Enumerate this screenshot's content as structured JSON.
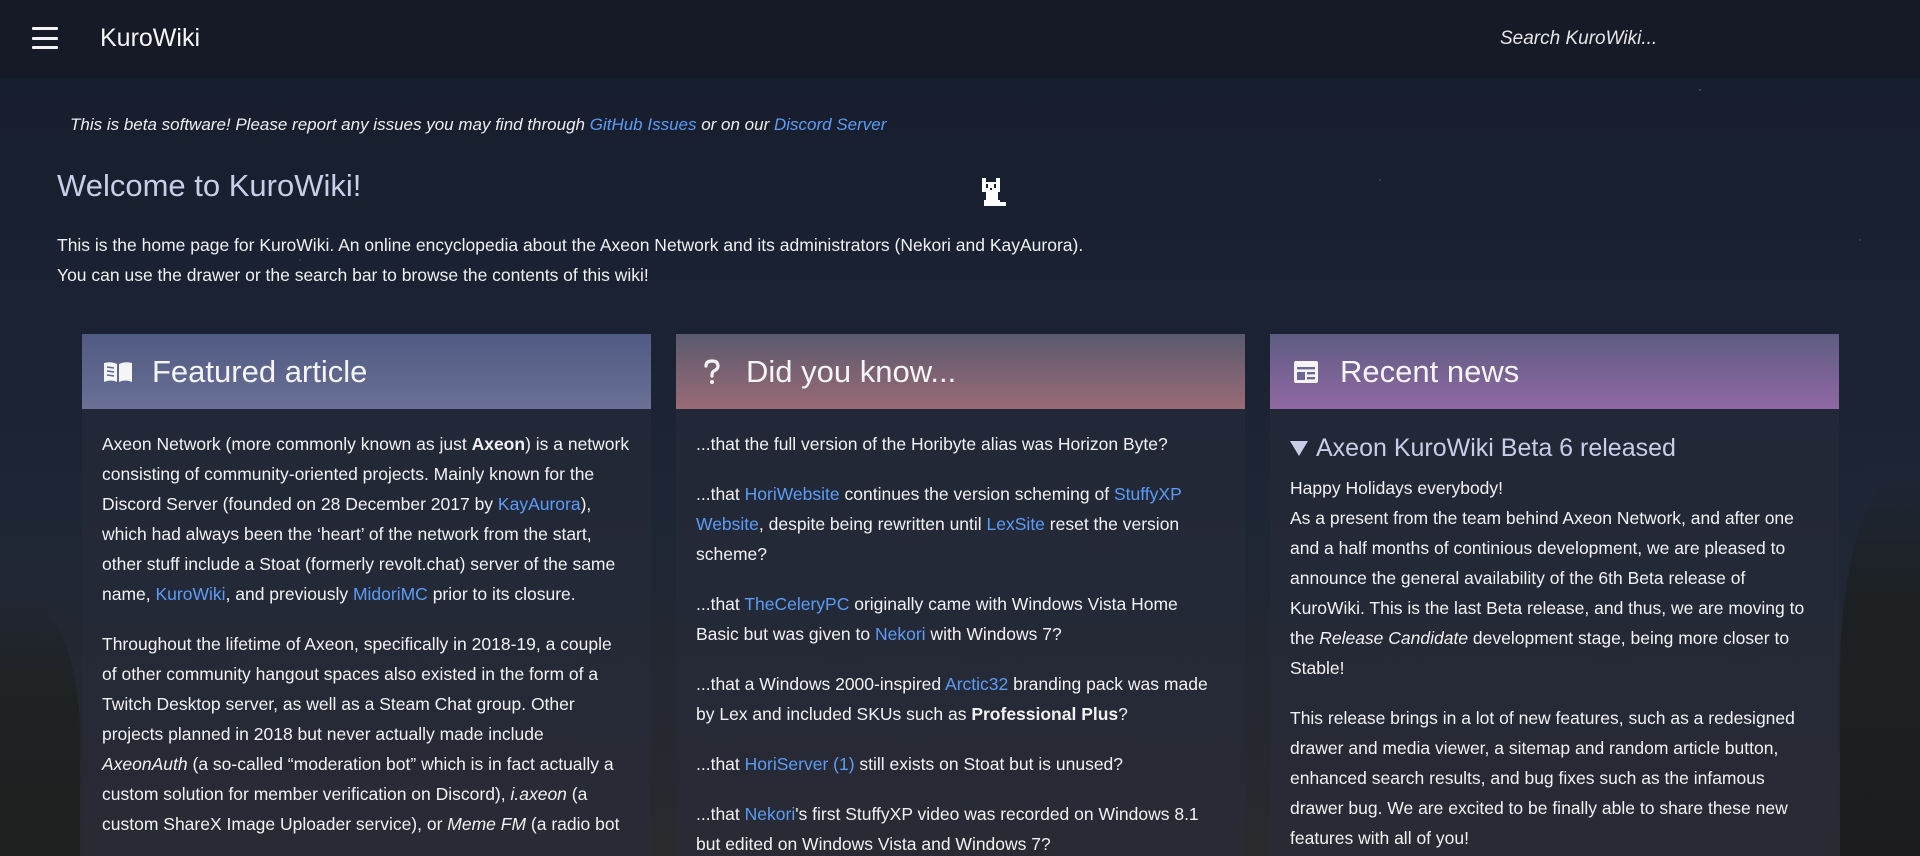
{
  "app": {
    "title": "KuroWiki"
  },
  "search": {
    "placeholder": "Search KuroWiki..."
  },
  "notice": {
    "text_before": "This is beta software! Please report any issues you may find through ",
    "github_link": "GitHub Issues",
    "text_middle": " or on our ",
    "discord_link": "Discord Server"
  },
  "page": {
    "title": "Welcome to KuroWiki!",
    "intro_line1": "This is the home page for KuroWiki. An online encyclopedia about the Axeon Network and its administrators (Nekori and KayAurora).",
    "intro_line2": "You can use the drawer or the search bar to browse the contents of this wiki!"
  },
  "featured": {
    "heading": "Featured article",
    "icon": "book-open-icon",
    "p1": {
      "t1": "Axeon Network (more commonly known as just ",
      "bold": "Axeon",
      "t2": ") is a network consisting of community-oriented projects. Mainly known for the Discord Server (founded on 28 December 2017 by ",
      "link1": "KayAurora",
      "t3": "), which had always been the ‘heart’ of the network from the start, other stuff include a Stoat (formerly revolt.chat) server of the same name, ",
      "link2": "KuroWiki",
      "t4": ", and previously ",
      "link3": "MidoriMC",
      "t5": " prior to its closure."
    },
    "p2": {
      "t1": "Throughout the lifetime of Axeon, specifically in 2018-19, a couple of other community hangout spaces also existed in the form of a Twitch Desktop server, as well as a Steam Chat group. Other projects planned in 2018 but never actually made include ",
      "i1": "AxeonAuth",
      "t2": " (a so-called “moderation bot” which is in fact actually a custom solution for member verification on Discord), ",
      "i2": "i.axeon",
      "t3": " (a custom ShareX Image Uploader service), or ",
      "i3": "Meme FM",
      "t4": " (a radio bot"
    }
  },
  "dyk": {
    "heading": "Did you know...",
    "icon": "question-mark-icon",
    "f1": "...that the full version of the Horibyte alias was Horizon Byte?",
    "f2": {
      "t1": "...that ",
      "l1": "HoriWebsite",
      "t2": " continues the version scheming of ",
      "l2": "StuffyXP Website",
      "t3": ", despite being rewritten until ",
      "l3": "LexSite",
      "t4": " reset the version scheme?"
    },
    "f3": {
      "t1": "...that ",
      "l1": "TheCeleryPC",
      "t2": " originally came with Windows Vista Home Basic but was given to ",
      "l2": "Nekori",
      "t3": " with Windows 7?"
    },
    "f4": {
      "t1": "...that a Windows 2000-inspired ",
      "l1": "Arctic32",
      "t2": " branding pack was made by Lex and included SKUs such as ",
      "b1": "Professional Plus",
      "t3": "?"
    },
    "f5": {
      "t1": "...that ",
      "l1": "HoriServer (1)",
      "t2": " still exists on Stoat but is unused?"
    },
    "f6": {
      "t1": "...that ",
      "l1": "Nekori",
      "t2": "'s first StuffyXP video was recorded on Windows 8.1 but edited on Windows Vista and Windows 7?"
    }
  },
  "news": {
    "heading": "Recent news",
    "icon": "newspaper-icon",
    "item_title": "Axeon KuroWiki Beta 6 released",
    "greeting": "Happy Holidays everybody!",
    "p1": {
      "t1": "As a present from the team behind Axeon Network, and after one and a half months of continious development, we are pleased to announce the general availability of the 6th Beta release of KuroWiki. This is the last Beta release, and thus, we are moving to the ",
      "i1": "Release Candidate",
      "t2": " development stage, being more closer to Stable!"
    },
    "p2": "This release brings in a lot of new features, such as a redesigned drawer and media viewer, a sitemap and random article button, enhanced search results, and bug fixes such as the infamous drawer bug. We are excited to be finally able to share these new features with all of you!"
  },
  "colors": {
    "link": "#5b9cf5",
    "title": "#c8cde8"
  }
}
